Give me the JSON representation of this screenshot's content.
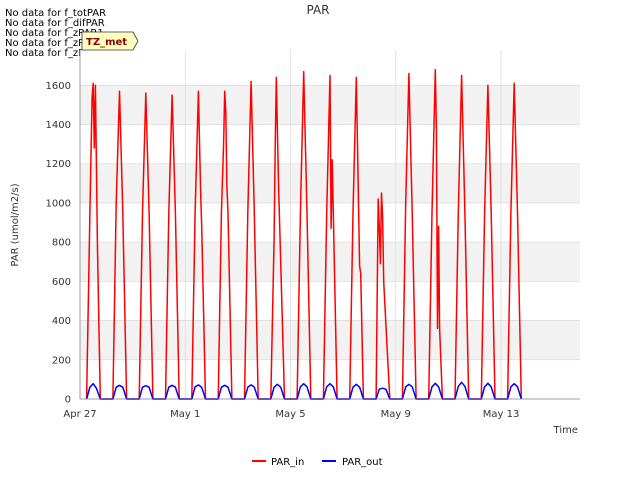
{
  "no_data_messages": [
    "No data for f_totPAR",
    "No data for f_difPAR",
    "No data for f_zPAR1",
    "No data for f_zPAR2",
    "No data for f_zPAR3"
  ],
  "badge": {
    "label": "TZ_met"
  },
  "colors": {
    "PAR_in": "#ff0000",
    "PAR_out": "#0000ff",
    "band": "#f2f2f2",
    "grid": "#dddddd"
  },
  "chart_data": {
    "type": "line",
    "title": "PAR",
    "xlabel": "Time",
    "ylabel": "PAR (umol/m2/s)",
    "xlim": [
      "2023-04-27",
      "2023-05-16"
    ],
    "ylim": [
      0,
      1780
    ],
    "yticks": [
      0,
      200,
      400,
      600,
      800,
      1000,
      1200,
      1400,
      1600
    ],
    "xticks": [
      {
        "date": "2023-04-27",
        "label": "Apr 27"
      },
      {
        "date": "2023-05-01",
        "label": "May 1"
      },
      {
        "date": "2023-05-05",
        "label": "May 5"
      },
      {
        "date": "2023-05-09",
        "label": "May 9"
      },
      {
        "date": "2023-05-13",
        "label": "May 13"
      }
    ],
    "grid": true,
    "legend_position": "bottom-center",
    "series": [
      {
        "name": "PAR_in",
        "x": [
          "2023-04-27 06:00",
          "2023-04-27 09:00",
          "2023-04-27 11:00",
          "2023-04-27 12:00",
          "2023-04-27 13:00",
          "2023-04-27 14:00",
          "2023-04-27 16:00",
          "2023-04-27 18:30",
          "2023-04-28 06:00",
          "2023-04-28 09:00",
          "2023-04-28 12:00",
          "2023-04-28 15:00",
          "2023-04-28 18:30",
          "2023-04-29 06:00",
          "2023-04-29 09:00",
          "2023-04-29 12:00",
          "2023-04-29 15:00",
          "2023-04-29 18:30",
          "2023-04-30 06:00",
          "2023-04-30 09:00",
          "2023-04-30 12:00",
          "2023-04-30 15:00",
          "2023-04-30 18:30",
          "2023-05-01 06:00",
          "2023-05-01 09:00",
          "2023-05-01 12:00",
          "2023-05-01 14:00",
          "2023-05-01 15:00",
          "2023-05-01 18:30",
          "2023-05-02 06:00",
          "2023-05-02 09:00",
          "2023-05-02 11:00",
          "2023-05-02 12:00",
          "2023-05-02 13:00",
          "2023-05-02 14:00",
          "2023-05-02 15:00",
          "2023-05-02 18:30",
          "2023-05-03 06:00",
          "2023-05-03 09:00",
          "2023-05-03 12:00",
          "2023-05-03 15:00",
          "2023-05-03 18:30",
          "2023-05-04 06:00",
          "2023-05-04 09:00",
          "2023-05-04 10:00",
          "2023-05-04 11:00",
          "2023-05-04 13:00",
          "2023-05-04 15:00",
          "2023-05-04 18:30",
          "2023-05-05 06:00",
          "2023-05-05 09:00",
          "2023-05-05 12:00",
          "2023-05-05 15:00",
          "2023-05-05 18:30",
          "2023-05-06 06:00",
          "2023-05-06 09:00",
          "2023-05-06 12:00",
          "2023-05-06 13:00",
          "2023-05-06 14:00",
          "2023-05-06 15:00",
          "2023-05-06 18:30",
          "2023-05-07 06:00",
          "2023-05-07 09:00",
          "2023-05-07 12:00",
          "2023-05-07 15:00",
          "2023-05-07 16:00",
          "2023-05-07 18:30",
          "2023-05-08 06:00",
          "2023-05-08 08:00",
          "2023-05-08 09:00",
          "2023-05-08 10:00",
          "2023-05-08 11:00",
          "2023-05-08 12:00",
          "2023-05-08 13:00",
          "2023-05-08 15:00",
          "2023-05-08 18:30",
          "2023-05-09 06:00",
          "2023-05-09 09:00",
          "2023-05-09 12:00",
          "2023-05-09 15:00",
          "2023-05-09 18:30",
          "2023-05-10 06:00",
          "2023-05-10 09:00",
          "2023-05-10 12:00",
          "2023-05-10 13:00",
          "2023-05-10 14:00",
          "2023-05-10 15:00",
          "2023-05-10 16:00",
          "2023-05-10 18:30",
          "2023-05-11 06:00",
          "2023-05-11 09:00",
          "2023-05-11 12:00",
          "2023-05-11 15:00",
          "2023-05-11 18:30",
          "2023-05-12 06:00",
          "2023-05-12 09:00",
          "2023-05-12 12:00",
          "2023-05-12 15:00",
          "2023-05-12 18:30",
          "2023-05-13 06:00",
          "2023-05-13 09:00",
          "2023-05-13 12:00",
          "2023-05-13 15:00",
          "2023-05-13 18:30"
        ],
        "y": [
          0,
          950,
          1540,
          1610,
          1280,
          1600,
          760,
          0,
          0,
          1000,
          1570,
          950,
          0,
          0,
          950,
          1560,
          950,
          0,
          0,
          950,
          1550,
          950,
          0,
          0,
          950,
          1570,
          1060,
          880,
          0,
          0,
          950,
          1300,
          1570,
          1460,
          1080,
          950,
          0,
          0,
          950,
          1620,
          950,
          0,
          0,
          820,
          1290,
          1640,
          1100,
          700,
          0,
          0,
          950,
          1670,
          950,
          0,
          0,
          950,
          1650,
          870,
          1220,
          950,
          0,
          0,
          950,
          1640,
          680,
          640,
          0,
          0,
          1020,
          880,
          690,
          1050,
          930,
          600,
          380,
          0,
          0,
          1000,
          1660,
          950,
          0,
          0,
          950,
          1680,
          1380,
          360,
          880,
          360,
          0,
          0,
          950,
          1650,
          950,
          0,
          0,
          950,
          1600,
          950,
          0,
          0,
          950,
          1610,
          950,
          0
        ]
      },
      {
        "name": "PAR_out",
        "x": [
          "2023-04-27 06:00",
          "2023-04-27 09:00",
          "2023-04-27 12:00",
          "2023-04-27 15:00",
          "2023-04-27 18:30",
          "2023-04-28 06:00",
          "2023-04-28 09:00",
          "2023-04-28 12:00",
          "2023-04-28 15:00",
          "2023-04-28 18:30",
          "2023-04-29 06:00",
          "2023-04-29 09:00",
          "2023-04-29 12:00",
          "2023-04-29 15:00",
          "2023-04-29 18:30",
          "2023-04-30 06:00",
          "2023-04-30 09:00",
          "2023-04-30 12:00",
          "2023-04-30 15:00",
          "2023-04-30 18:30",
          "2023-05-01 06:00",
          "2023-05-01 09:00",
          "2023-05-01 12:00",
          "2023-05-01 15:00",
          "2023-05-01 18:30",
          "2023-05-02 06:00",
          "2023-05-02 09:00",
          "2023-05-02 12:00",
          "2023-05-02 15:00",
          "2023-05-02 18:30",
          "2023-05-03 06:00",
          "2023-05-03 09:00",
          "2023-05-03 12:00",
          "2023-05-03 15:00",
          "2023-05-03 18:30",
          "2023-05-04 06:00",
          "2023-05-04 09:00",
          "2023-05-04 12:00",
          "2023-05-04 15:00",
          "2023-05-04 18:30",
          "2023-05-05 06:00",
          "2023-05-05 09:00",
          "2023-05-05 12:00",
          "2023-05-05 15:00",
          "2023-05-05 18:30",
          "2023-05-06 06:00",
          "2023-05-06 09:00",
          "2023-05-06 12:00",
          "2023-05-06 15:00",
          "2023-05-06 18:30",
          "2023-05-07 06:00",
          "2023-05-07 09:00",
          "2023-05-07 12:00",
          "2023-05-07 15:00",
          "2023-05-07 18:30",
          "2023-05-08 06:00",
          "2023-05-08 09:00",
          "2023-05-08 12:00",
          "2023-05-08 15:00",
          "2023-05-08 18:30",
          "2023-05-09 06:00",
          "2023-05-09 09:00",
          "2023-05-09 12:00",
          "2023-05-09 15:00",
          "2023-05-09 18:30",
          "2023-05-10 06:00",
          "2023-05-10 09:00",
          "2023-05-10 12:00",
          "2023-05-10 15:00",
          "2023-05-10 18:30",
          "2023-05-11 06:00",
          "2023-05-11 09:00",
          "2023-05-11 12:00",
          "2023-05-11 15:00",
          "2023-05-11 18:30",
          "2023-05-12 06:00",
          "2023-05-12 09:00",
          "2023-05-12 12:00",
          "2023-05-12 15:00",
          "2023-05-12 18:30",
          "2023-05-13 06:00",
          "2023-05-13 09:00",
          "2023-05-13 12:00",
          "2023-05-13 15:00",
          "2023-05-13 18:30"
        ],
        "y": [
          0,
          60,
          78,
          55,
          0,
          0,
          60,
          70,
          60,
          0,
          0,
          60,
          68,
          60,
          0,
          0,
          60,
          70,
          60,
          0,
          0,
          62,
          72,
          60,
          0,
          0,
          60,
          70,
          60,
          0,
          0,
          60,
          72,
          60,
          0,
          0,
          60,
          75,
          60,
          0,
          0,
          62,
          78,
          62,
          0,
          0,
          62,
          78,
          62,
          0,
          0,
          60,
          75,
          60,
          0,
          0,
          50,
          55,
          50,
          0,
          0,
          62,
          75,
          62,
          0,
          0,
          62,
          80,
          62,
          0,
          0,
          65,
          85,
          65,
          0,
          0,
          62,
          80,
          62,
          0,
          0,
          62,
          78,
          62,
          0
        ]
      }
    ]
  }
}
